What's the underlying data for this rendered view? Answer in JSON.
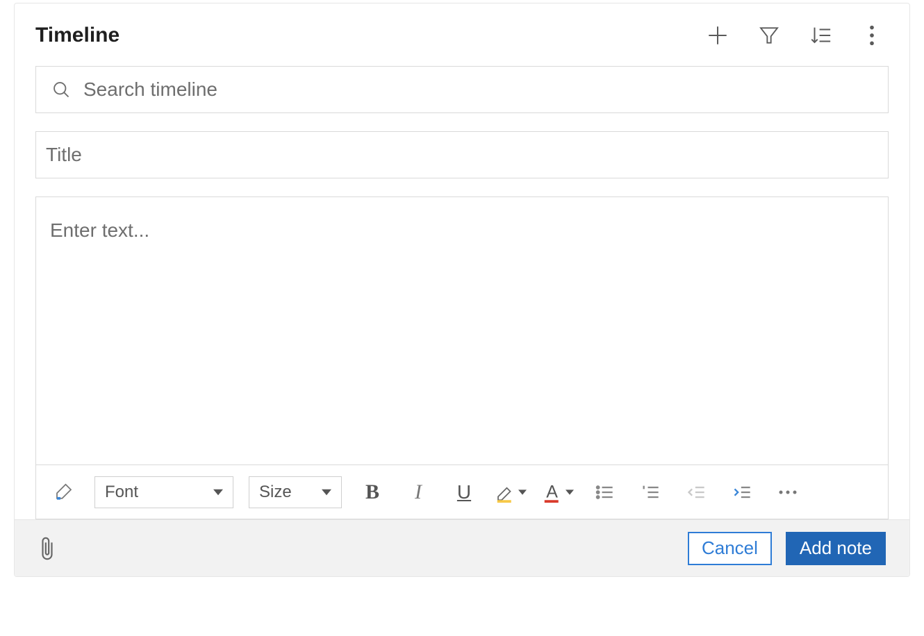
{
  "header": {
    "title": "Timeline",
    "icons": {
      "add": "add-icon",
      "filter": "filter-icon",
      "sort": "sort-icon",
      "more": "more-vertical-icon"
    }
  },
  "search": {
    "placeholder": "Search timeline",
    "value": ""
  },
  "note": {
    "title_placeholder": "Title",
    "title_value": "",
    "body_placeholder": "Enter text...",
    "body_value": ""
  },
  "toolbar": {
    "format_painter": "format-painter-icon",
    "font_label": "Font",
    "size_label": "Size",
    "bold": "bold-icon",
    "italic": "italic-icon",
    "underline": "underline-icon",
    "highlight": "highlight-icon",
    "font_color": "font-color-icon",
    "bullet_list": "bullet-list-icon",
    "number_list": "number-list-icon",
    "outdent": "outdent-icon",
    "indent": "indent-icon",
    "overflow": "more-horizontal-icon"
  },
  "footer": {
    "attach": "paperclip-icon",
    "cancel_label": "Cancel",
    "submit_label": "Add note"
  },
  "colors": {
    "accent": "#2166b5",
    "accent_light": "#2e7cd6"
  }
}
